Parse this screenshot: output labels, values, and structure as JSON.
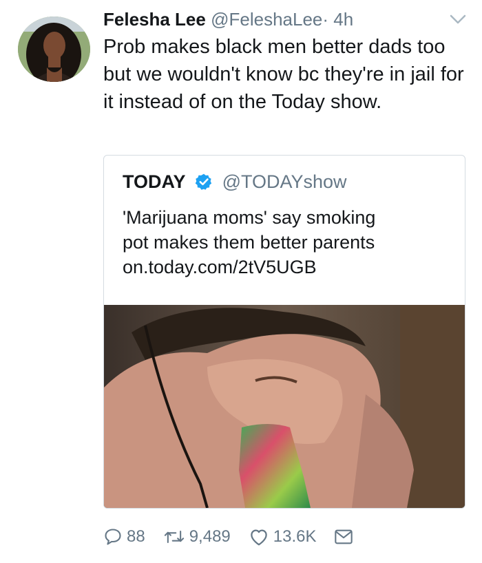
{
  "tweet": {
    "author_name": "Felesha Lee",
    "author_handle": "@FeleshaLee",
    "separator": "·",
    "timestamp": "4h",
    "text": "Prob makes black men better dads too but we wouldn't know bc they're in jail for it instead of on the Today show."
  },
  "quoted_tweet": {
    "name": "TODAY",
    "handle": "@TODAYshow",
    "text_lines": [
      "'Marijuana moms' say smoking",
      "pot makes them better parents",
      "on.today.com/2tV5UGB"
    ]
  },
  "actions": {
    "replies": "88",
    "retweets": "9,489",
    "likes": "13.6K"
  },
  "icons": {
    "reply": "reply-icon",
    "retweet": "retweet-icon",
    "like": "heart-icon",
    "message": "envelope-icon",
    "verified": "verified-badge-icon",
    "menu": "chevron-down-icon"
  },
  "colors": {
    "text": "#14171a",
    "secondary": "#657786",
    "verified": "#1da1f2",
    "border": "#d4dbe1"
  }
}
